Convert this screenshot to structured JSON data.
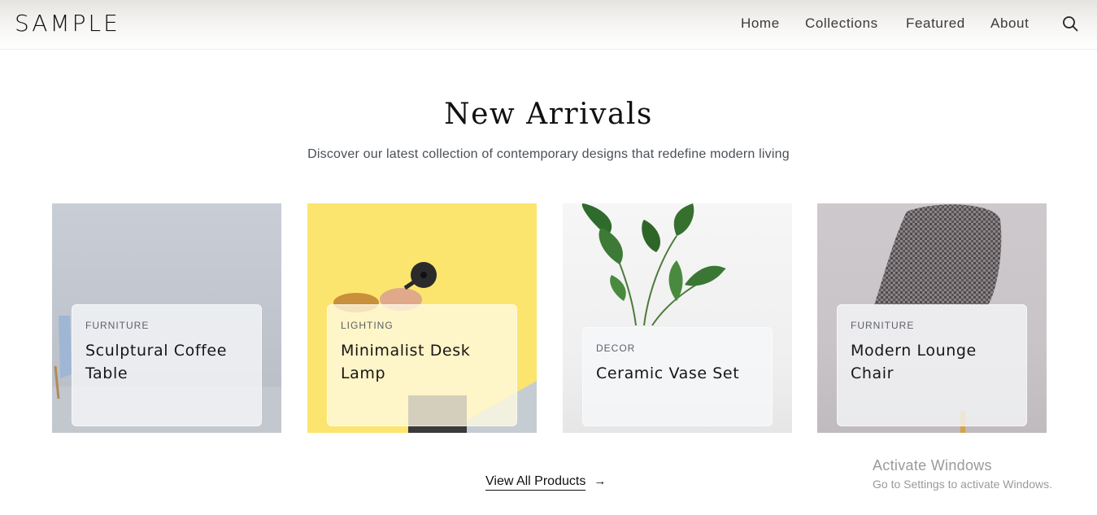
{
  "header": {
    "logo": "SAMPLE",
    "nav": [
      {
        "label": "Home"
      },
      {
        "label": "Collections"
      },
      {
        "label": "Featured"
      },
      {
        "label": "About"
      }
    ],
    "search_icon": "search-icon"
  },
  "hero": {
    "title": "New Arrivals",
    "subtitle": "Discover our latest collection of contemporary designs that redefine modern living"
  },
  "products": [
    {
      "category": "FURNITURE",
      "name": "Sculptural Coffee Table"
    },
    {
      "category": "LIGHTING",
      "name": "Minimalist Desk Lamp"
    },
    {
      "category": "DECOR",
      "name": "Ceramic Vase Set"
    },
    {
      "category": "FURNITURE",
      "name": "Modern Lounge Chair"
    }
  ],
  "cta": {
    "label": "View All Products",
    "arrow": "→"
  },
  "watermark": {
    "line1": "Activate Windows",
    "line2": "Go to Settings to activate Windows."
  },
  "colors": {
    "lamp_bg": "#fbe56f",
    "text": "#111111",
    "muted": "#4a4f57"
  }
}
